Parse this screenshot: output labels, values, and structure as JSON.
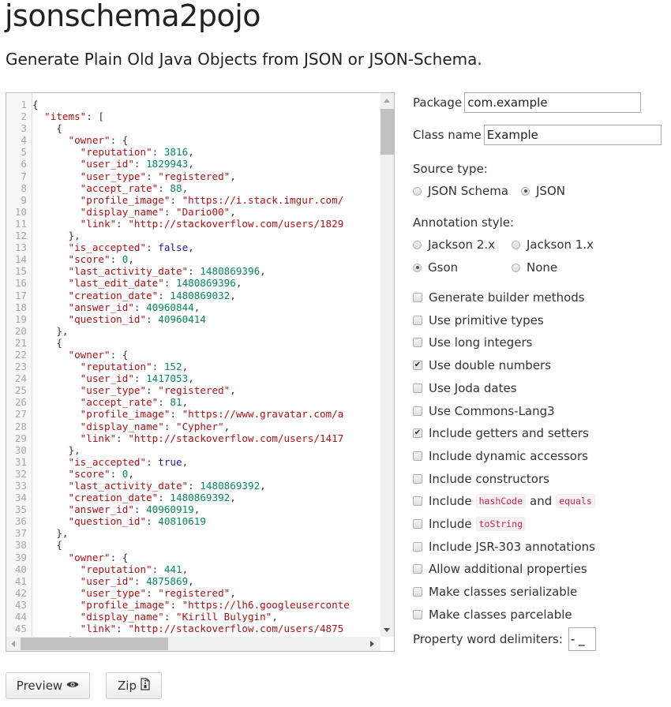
{
  "header": {
    "title": "jsonschema2pojo",
    "subtitle": "Generate Plain Old Java Objects from JSON or JSON-Schema."
  },
  "editor": {
    "lines": [
      [
        [
          "p",
          "{"
        ]
      ],
      [
        [
          "p",
          "  "
        ],
        [
          "k",
          "\"items\""
        ],
        [
          "p",
          ": ["
        ]
      ],
      [
        [
          "p",
          "    {"
        ]
      ],
      [
        [
          "p",
          "      "
        ],
        [
          "k",
          "\"owner\""
        ],
        [
          "p",
          ": {"
        ]
      ],
      [
        [
          "p",
          "        "
        ],
        [
          "k",
          "\"reputation\""
        ],
        [
          "p",
          ": "
        ],
        [
          "n",
          "3816"
        ],
        [
          "p",
          ","
        ]
      ],
      [
        [
          "p",
          "        "
        ],
        [
          "k",
          "\"user_id\""
        ],
        [
          "p",
          ": "
        ],
        [
          "n",
          "1829943"
        ],
        [
          "p",
          ","
        ]
      ],
      [
        [
          "p",
          "        "
        ],
        [
          "k",
          "\"user_type\""
        ],
        [
          "p",
          ": "
        ],
        [
          "s",
          "\"registered\""
        ],
        [
          "p",
          ","
        ]
      ],
      [
        [
          "p",
          "        "
        ],
        [
          "k",
          "\"accept_rate\""
        ],
        [
          "p",
          ": "
        ],
        [
          "n",
          "88"
        ],
        [
          "p",
          ","
        ]
      ],
      [
        [
          "p",
          "        "
        ],
        [
          "k",
          "\"profile_image\""
        ],
        [
          "p",
          ": "
        ],
        [
          "s",
          "\"https://i.stack.imgur.com/"
        ]
      ],
      [
        [
          "p",
          "        "
        ],
        [
          "k",
          "\"display_name\""
        ],
        [
          "p",
          ": "
        ],
        [
          "s",
          "\"Dario00\""
        ],
        [
          "p",
          ","
        ]
      ],
      [
        [
          "p",
          "        "
        ],
        [
          "k",
          "\"link\""
        ],
        [
          "p",
          ": "
        ],
        [
          "s",
          "\"http://stackoverflow.com/users/1829"
        ]
      ],
      [
        [
          "p",
          "      },"
        ]
      ],
      [
        [
          "p",
          "      "
        ],
        [
          "k",
          "\"is_accepted\""
        ],
        [
          "p",
          ": "
        ],
        [
          "b",
          "false"
        ],
        [
          "p",
          ","
        ]
      ],
      [
        [
          "p",
          "      "
        ],
        [
          "k",
          "\"score\""
        ],
        [
          "p",
          ": "
        ],
        [
          "n",
          "0"
        ],
        [
          "p",
          ","
        ]
      ],
      [
        [
          "p",
          "      "
        ],
        [
          "k",
          "\"last_activity_date\""
        ],
        [
          "p",
          ": "
        ],
        [
          "n",
          "1480869396"
        ],
        [
          "p",
          ","
        ]
      ],
      [
        [
          "p",
          "      "
        ],
        [
          "k",
          "\"last_edit_date\""
        ],
        [
          "p",
          ": "
        ],
        [
          "n",
          "1480869396"
        ],
        [
          "p",
          ","
        ]
      ],
      [
        [
          "p",
          "      "
        ],
        [
          "k",
          "\"creation_date\""
        ],
        [
          "p",
          ": "
        ],
        [
          "n",
          "1480869032"
        ],
        [
          "p",
          ","
        ]
      ],
      [
        [
          "p",
          "      "
        ],
        [
          "k",
          "\"answer_id\""
        ],
        [
          "p",
          ": "
        ],
        [
          "n",
          "40960844"
        ],
        [
          "p",
          ","
        ]
      ],
      [
        [
          "p",
          "      "
        ],
        [
          "k",
          "\"question_id\""
        ],
        [
          "p",
          ": "
        ],
        [
          "n",
          "40960414"
        ]
      ],
      [
        [
          "p",
          "    },"
        ]
      ],
      [
        [
          "p",
          "    {"
        ]
      ],
      [
        [
          "p",
          "      "
        ],
        [
          "k",
          "\"owner\""
        ],
        [
          "p",
          ": {"
        ]
      ],
      [
        [
          "p",
          "        "
        ],
        [
          "k",
          "\"reputation\""
        ],
        [
          "p",
          ": "
        ],
        [
          "n",
          "152"
        ],
        [
          "p",
          ","
        ]
      ],
      [
        [
          "p",
          "        "
        ],
        [
          "k",
          "\"user_id\""
        ],
        [
          "p",
          ": "
        ],
        [
          "n",
          "1417053"
        ],
        [
          "p",
          ","
        ]
      ],
      [
        [
          "p",
          "        "
        ],
        [
          "k",
          "\"user_type\""
        ],
        [
          "p",
          ": "
        ],
        [
          "s",
          "\"registered\""
        ],
        [
          "p",
          ","
        ]
      ],
      [
        [
          "p",
          "        "
        ],
        [
          "k",
          "\"accept_rate\""
        ],
        [
          "p",
          ": "
        ],
        [
          "n",
          "81"
        ],
        [
          "p",
          ","
        ]
      ],
      [
        [
          "p",
          "        "
        ],
        [
          "k",
          "\"profile_image\""
        ],
        [
          "p",
          ": "
        ],
        [
          "s",
          "\"https://www.gravatar.com/a"
        ]
      ],
      [
        [
          "p",
          "        "
        ],
        [
          "k",
          "\"display_name\""
        ],
        [
          "p",
          ": "
        ],
        [
          "s",
          "\"Cypher\""
        ],
        [
          "p",
          ","
        ]
      ],
      [
        [
          "p",
          "        "
        ],
        [
          "k",
          "\"link\""
        ],
        [
          "p",
          ": "
        ],
        [
          "s",
          "\"http://stackoverflow.com/users/1417"
        ]
      ],
      [
        [
          "p",
          "      },"
        ]
      ],
      [
        [
          "p",
          "      "
        ],
        [
          "k",
          "\"is_accepted\""
        ],
        [
          "p",
          ": "
        ],
        [
          "b",
          "true"
        ],
        [
          "p",
          ","
        ]
      ],
      [
        [
          "p",
          "      "
        ],
        [
          "k",
          "\"score\""
        ],
        [
          "p",
          ": "
        ],
        [
          "n",
          "0"
        ],
        [
          "p",
          ","
        ]
      ],
      [
        [
          "p",
          "      "
        ],
        [
          "k",
          "\"last_activity_date\""
        ],
        [
          "p",
          ": "
        ],
        [
          "n",
          "1480869392"
        ],
        [
          "p",
          ","
        ]
      ],
      [
        [
          "p",
          "      "
        ],
        [
          "k",
          "\"creation_date\""
        ],
        [
          "p",
          ": "
        ],
        [
          "n",
          "1480869392"
        ],
        [
          "p",
          ","
        ]
      ],
      [
        [
          "p",
          "      "
        ],
        [
          "k",
          "\"answer_id\""
        ],
        [
          "p",
          ": "
        ],
        [
          "n",
          "40960919"
        ],
        [
          "p",
          ","
        ]
      ],
      [
        [
          "p",
          "      "
        ],
        [
          "k",
          "\"question_id\""
        ],
        [
          "p",
          ": "
        ],
        [
          "n",
          "40810619"
        ]
      ],
      [
        [
          "p",
          "    },"
        ]
      ],
      [
        [
          "p",
          "    {"
        ]
      ],
      [
        [
          "p",
          "      "
        ],
        [
          "k",
          "\"owner\""
        ],
        [
          "p",
          ": {"
        ]
      ],
      [
        [
          "p",
          "        "
        ],
        [
          "k",
          "\"reputation\""
        ],
        [
          "p",
          ": "
        ],
        [
          "n",
          "441"
        ],
        [
          "p",
          ","
        ]
      ],
      [
        [
          "p",
          "        "
        ],
        [
          "k",
          "\"user_id\""
        ],
        [
          "p",
          ": "
        ],
        [
          "n",
          "4875869"
        ],
        [
          "p",
          ","
        ]
      ],
      [
        [
          "p",
          "        "
        ],
        [
          "k",
          "\"user_type\""
        ],
        [
          "p",
          ": "
        ],
        [
          "s",
          "\"registered\""
        ],
        [
          "p",
          ","
        ]
      ],
      [
        [
          "p",
          "        "
        ],
        [
          "k",
          "\"profile_image\""
        ],
        [
          "p",
          ": "
        ],
        [
          "s",
          "\"https://lh6.googleuserconte"
        ]
      ],
      [
        [
          "p",
          "        "
        ],
        [
          "k",
          "\"display_name\""
        ],
        [
          "p",
          ": "
        ],
        [
          "s",
          "\"Kirill Bulygin\""
        ],
        [
          "p",
          ","
        ]
      ],
      [
        [
          "p",
          "        "
        ],
        [
          "k",
          "\"link\""
        ],
        [
          "p",
          ": "
        ],
        [
          "s",
          "\"http://stackoverflow.com/users/4875"
        ]
      ],
      [
        [
          "p",
          "      }"
        ]
      ]
    ]
  },
  "form": {
    "package_label": "Package",
    "package_value": "com.example",
    "classname_label": "Class name",
    "classname_value": "Example",
    "source_type_label": "Source type:",
    "source_types": [
      {
        "label": "JSON Schema",
        "selected": false
      },
      {
        "label": "JSON",
        "selected": true
      }
    ],
    "annotation_label": "Annotation style:",
    "annotations": [
      {
        "label": "Jackson 2.x",
        "selected": false
      },
      {
        "label": "Jackson 1.x",
        "selected": false
      },
      {
        "label": "Gson",
        "selected": true
      },
      {
        "label": "None",
        "selected": false
      }
    ],
    "options": [
      {
        "label": "Generate builder methods",
        "checked": false
      },
      {
        "label": "Use primitive types",
        "checked": false
      },
      {
        "label": "Use long integers",
        "checked": false
      },
      {
        "label": "Use double numbers",
        "checked": true
      },
      {
        "label": "Use Joda dates",
        "checked": false
      },
      {
        "label": "Use Commons-Lang3",
        "checked": false
      },
      {
        "label": "Include getters and setters",
        "checked": true
      },
      {
        "label": "Include dynamic accessors",
        "checked": false
      },
      {
        "label": "Include constructors",
        "checked": false
      },
      {
        "label": "Include",
        "code1": "hashCode",
        "mid": "and",
        "code2": "equals",
        "checked": false
      },
      {
        "label": "Include",
        "code1": "toString",
        "checked": false
      },
      {
        "label": "Include JSR-303 annotations",
        "checked": false
      },
      {
        "label": "Allow additional properties",
        "checked": false
      },
      {
        "label": "Make classes serializable",
        "checked": false
      },
      {
        "label": "Make classes parcelable",
        "checked": false
      }
    ],
    "delimiters_label": "Property word delimiters:",
    "delimiters_value": "- _"
  },
  "buttons": {
    "preview_label": "Preview",
    "preview_icon": "eye-icon",
    "zip_label": "Zip",
    "zip_icon": "file-zip-icon"
  }
}
